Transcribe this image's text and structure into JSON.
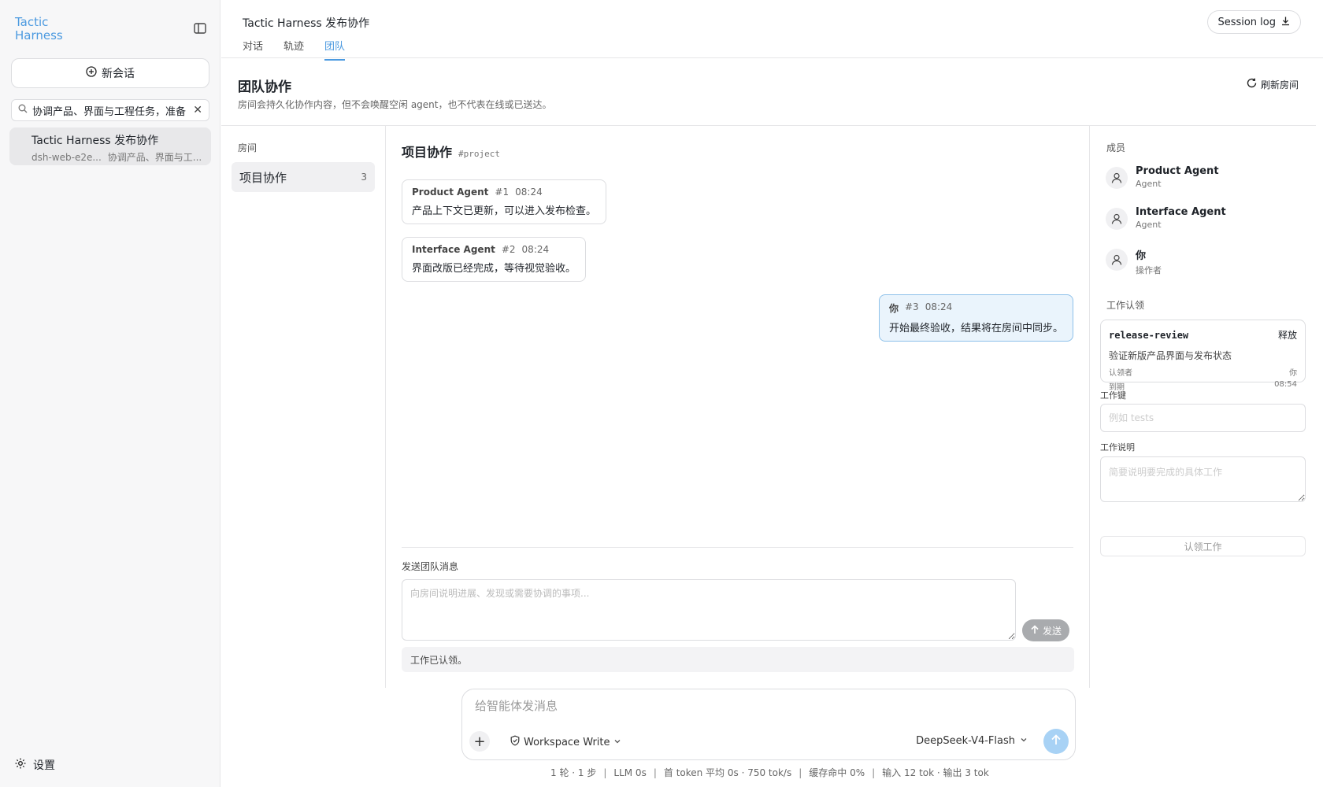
{
  "app": {
    "logo_line1": "Tactic",
    "logo_line2": "Harness"
  },
  "sidebar": {
    "new_chat_label": "新会话",
    "search_value": "协调产品、界面与工程任务，准备",
    "sessions": [
      {
        "title": "Tactic Harness 发布协作",
        "id_short": "dsh-web-e2e...",
        "preview": "协调产品、界面与工..."
      }
    ],
    "settings_label": "设置"
  },
  "header": {
    "title": "Tactic Harness 发布协作",
    "tabs": [
      {
        "label": "对话"
      },
      {
        "label": "轨迹"
      },
      {
        "label": "团队"
      }
    ],
    "active_tab": "团队",
    "session_log_label": "Session log"
  },
  "team": {
    "title": "团队协作",
    "description": "房间会持久化协作内容，但不会唤醒空闲 agent，也不代表在线或已送达。",
    "refresh_label": "刷新房间"
  },
  "rooms": {
    "label": "房间",
    "items": [
      {
        "name": "项目协作",
        "count": "3"
      }
    ]
  },
  "chat": {
    "room_title": "项目协作",
    "room_handle": "#project",
    "messages": [
      {
        "author": "Product Agent",
        "seq": "#1",
        "time": "08:24",
        "text": "产品上下文已更新，可以进入发布检查。"
      },
      {
        "author": "Interface Agent",
        "seq": "#2",
        "time": "08:24",
        "text": "界面改版已经完成，等待视觉验收。"
      },
      {
        "author": "你",
        "seq": "#3",
        "time": "08:24",
        "text": "开始最终验收，结果将在房间中同步。"
      }
    ],
    "compose_label": "发送团队消息",
    "compose_placeholder": "向房间说明进展、发现或需要协调的事项...",
    "send_label": "发送",
    "status_text": "工作已认领。"
  },
  "members": {
    "label": "成员",
    "items": [
      {
        "name": "Product Agent",
        "role": "Agent"
      },
      {
        "name": "Interface Agent",
        "role": "Agent"
      },
      {
        "name": "你",
        "role": "操作者"
      }
    ]
  },
  "claims": {
    "label": "工作认领",
    "card": {
      "key": "release-review",
      "release_label": "释放",
      "description": "验证新版产品界面与发布状态",
      "claimant_label": "认领者",
      "claimant_value": "你",
      "due_label": "到期",
      "due_value": "08:54"
    },
    "work_key_label": "工作键",
    "work_key_placeholder": "例如 tests",
    "work_desc_label": "工作说明",
    "work_desc_placeholder": "简要说明要完成的具体工作",
    "claim_button_label": "认领工作"
  },
  "composer": {
    "placeholder": "给智能体发消息",
    "mode_label": "Workspace Write",
    "model_label": "DeepSeek-V4-Flash"
  },
  "footer": {
    "stats": [
      "1 轮 · 1 步",
      "LLM 0s",
      "首 token 平均 0s · 750 tok/s",
      "缓存命中 0%",
      "输入 12 tok · 输出 3 tok"
    ]
  },
  "colors": {
    "accent": "#4c9ae0",
    "self_bubble_bg": "#eaf4fc",
    "self_bubble_border": "#8ec1ea"
  }
}
